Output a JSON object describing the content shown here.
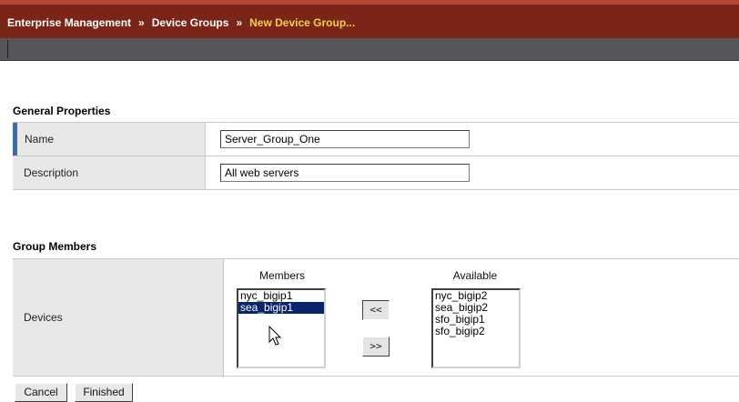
{
  "breadcrumb": {
    "items": [
      "Enterprise Management",
      "Device Groups"
    ],
    "separator": "»",
    "current": "New Device Group..."
  },
  "general": {
    "title": "General Properties",
    "name_label": "Name",
    "name_value": "Server_Group_One",
    "description_label": "Description",
    "description_value": "All web servers"
  },
  "group": {
    "title": "Group Members",
    "devices_label": "Devices",
    "members_header": "Members",
    "available_header": "Available",
    "members": [
      {
        "label": "nyc_bigip1",
        "selected": false
      },
      {
        "label": "sea_bigip1",
        "selected": true
      }
    ],
    "available": [
      {
        "label": "nyc_bigip2",
        "selected": false
      },
      {
        "label": "sea_bigip2",
        "selected": false
      },
      {
        "label": "sfo_bigip1",
        "selected": false
      },
      {
        "label": "sfo_bigip2",
        "selected": false
      }
    ],
    "move_left_label": "<<",
    "move_right_label": ">>"
  },
  "actions": {
    "cancel_label": "Cancel",
    "finished_label": "Finished"
  },
  "colors": {
    "header_bg": "#7b2418",
    "breadcrumb_current": "#f5d04a",
    "selection": "#0a246a",
    "active_marker": "#3d6ca8"
  }
}
